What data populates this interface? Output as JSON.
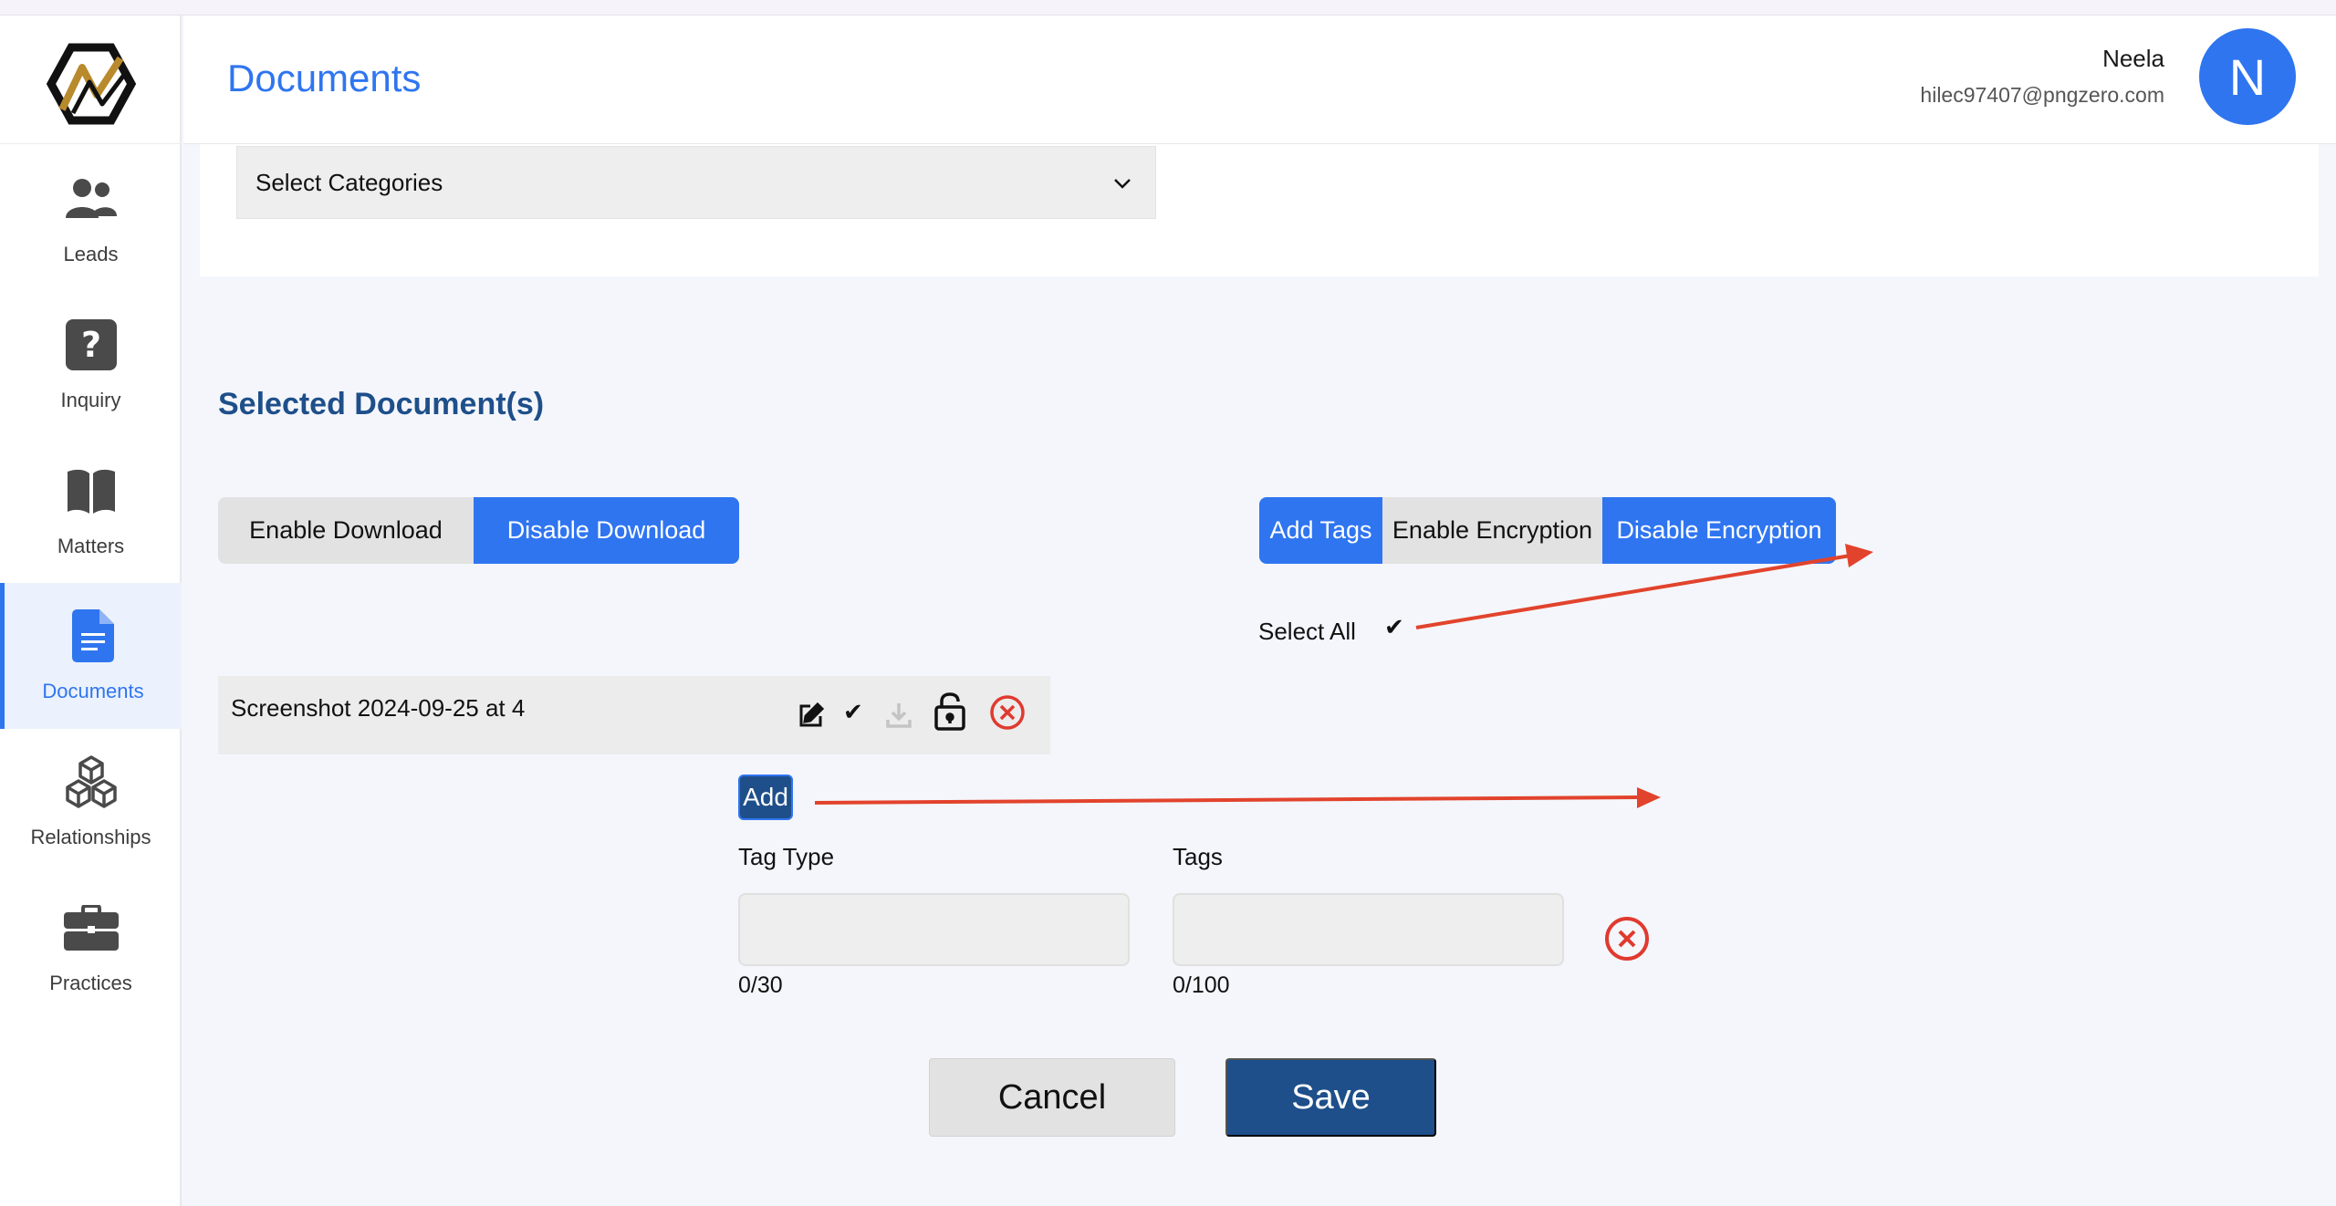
{
  "header": {
    "title": "Documents",
    "user_name": "Neela",
    "user_email": "hilec97407@pngzero.com",
    "avatar_initial": "N"
  },
  "sidebar": {
    "items": [
      {
        "label": "Leads",
        "icon": "users-icon"
      },
      {
        "label": "Inquiry",
        "icon": "question-icon"
      },
      {
        "label": "Matters",
        "icon": "book-icon"
      },
      {
        "label": "Documents",
        "icon": "document-icon",
        "active": true
      },
      {
        "label": "Relationships",
        "icon": "cubes-icon"
      },
      {
        "label": "Practices",
        "icon": "briefcase-icon"
      }
    ]
  },
  "filter": {
    "category_placeholder": "Select Categories"
  },
  "selected": {
    "title": "Selected Document(s)",
    "enable_download": "Enable Download",
    "disable_download": "Disable Download",
    "add_tags": "Add Tags",
    "enable_encryption": "Enable Encryption",
    "disable_encryption": "Disable Encryption",
    "select_all": "Select All",
    "check_mark": "✔"
  },
  "document": {
    "name": "Screenshot 2024-09-25 at 4"
  },
  "tags": {
    "add_label": "Add",
    "tag_type_label": "Tag Type",
    "tags_label": "Tags",
    "tag_type_value": "",
    "tags_value": "",
    "tag_type_counter": "0/30",
    "tags_counter": "0/100"
  },
  "actions": {
    "cancel": "Cancel",
    "save": "Save"
  },
  "colors": {
    "accent": "#2f75f0",
    "navy": "#1e4f8a",
    "danger": "#e03a2f",
    "annotation": "#e2432c"
  }
}
